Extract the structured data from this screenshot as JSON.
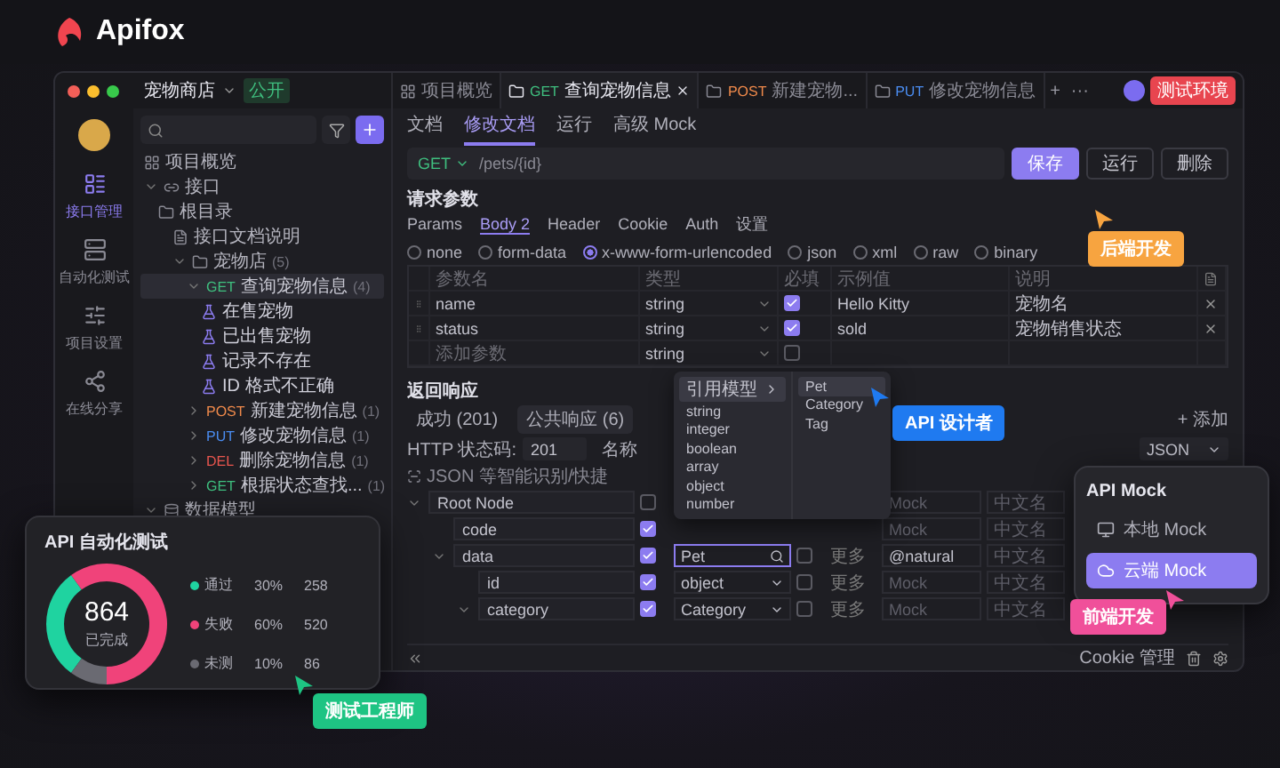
{
  "header": {
    "brand": "Apifox"
  },
  "window": {
    "project": "宠物商店",
    "visibility": "公开",
    "environment": "测试环境",
    "add_tab": "+",
    "more_tabs": "···",
    "tabs": [
      {
        "kind": "overview",
        "label": "项目概览",
        "selected": false
      },
      {
        "kind": "api",
        "method": "GET",
        "color": "#3fbf7f",
        "label": "查询宠物信息",
        "selected": true
      },
      {
        "kind": "api",
        "method": "POST",
        "color": "#f08a4b",
        "label": "新建宠物...",
        "selected": false
      },
      {
        "kind": "api",
        "method": "PUT",
        "color": "#4a8cf0",
        "label": "修改宠物信息",
        "selected": false
      }
    ]
  },
  "nav": [
    {
      "kind": "api",
      "label": "接口管理",
      "selected": true
    },
    {
      "kind": "test",
      "label": "自动化测试",
      "selected": false
    },
    {
      "kind": "settings",
      "label": "项目设置",
      "selected": false
    },
    {
      "kind": "share",
      "label": "在线分享",
      "selected": false
    }
  ],
  "tree": {
    "items": [
      {
        "kind": "overview",
        "label": "项目概览",
        "selected": false
      },
      {
        "kind": "api-group",
        "label": "接口",
        "selected": false,
        "expanded": true,
        "children": [
          {
            "kind": "folder",
            "label": "根目录",
            "selected": false,
            "children": [
              {
                "kind": "doc",
                "label": "接口文档说明",
                "selected": false
              },
              {
                "kind": "folder",
                "label": "宠物店",
                "count": "(5)",
                "selected": false,
                "expanded": true,
                "children": [
                  {
                    "kind": "api",
                    "method": "GET",
                    "color": "#3fbf7f",
                    "label": "查询宠物信息",
                    "count": "(4)",
                    "selected": true,
                    "expanded": true,
                    "children": [
                      {
                        "kind": "case",
                        "label": "在售宠物",
                        "selected": false
                      },
                      {
                        "kind": "case",
                        "label": "已出售宠物",
                        "selected": false
                      },
                      {
                        "kind": "case",
                        "label": "记录不存在",
                        "selected": false
                      },
                      {
                        "kind": "case",
                        "label": "ID 格式不正确",
                        "selected": false
                      }
                    ]
                  },
                  {
                    "kind": "api",
                    "method": "POST",
                    "color": "#f08a4b",
                    "label": "新建宠物信息",
                    "count": "(1)",
                    "selected": false,
                    "expanded": false
                  },
                  {
                    "kind": "api",
                    "method": "PUT",
                    "color": "#4a8cf0",
                    "label": "修改宠物信息",
                    "count": "(1)",
                    "selected": false,
                    "expanded": false
                  },
                  {
                    "kind": "api",
                    "method": "DEL",
                    "color": "#e8554e",
                    "label": "删除宠物信息",
                    "count": "(1)",
                    "selected": false,
                    "expanded": false
                  },
                  {
                    "kind": "api",
                    "method": "GET",
                    "color": "#3fbf7f",
                    "label": "根据状态查找...",
                    "count": "(1)",
                    "selected": false,
                    "expanded": false
                  }
                ]
              }
            ]
          }
        ]
      },
      {
        "kind": "model",
        "label": "数据模型",
        "selected": false,
        "expanded": true
      }
    ]
  },
  "doc_tabs": [
    {
      "label": "文档",
      "selected": false
    },
    {
      "label": "修改文档",
      "selected": true
    },
    {
      "label": "运行",
      "selected": false
    },
    {
      "label": "高级 Mock",
      "selected": false
    }
  ],
  "request": {
    "method": "GET",
    "path": "/pets/{id}",
    "buttons": [
      {
        "kind": "primary",
        "label": "保存"
      },
      {
        "kind": "plain",
        "label": "运行"
      },
      {
        "kind": "plain",
        "label": "删除"
      }
    ]
  },
  "params": {
    "title": "请求参数",
    "tabs": [
      {
        "label": "Params",
        "selected": false
      },
      {
        "label": "Body",
        "count": "2",
        "selected": true
      },
      {
        "label": "Header",
        "selected": false
      },
      {
        "label": "Cookie",
        "selected": false
      },
      {
        "label": "Auth",
        "selected": false
      },
      {
        "label": "设置",
        "selected": false
      }
    ],
    "body_types": [
      {
        "label": "none",
        "selected": false
      },
      {
        "label": "form-data",
        "selected": false
      },
      {
        "label": "x-www-form-urlencoded",
        "selected": true
      },
      {
        "label": "json",
        "selected": false
      },
      {
        "label": "xml",
        "selected": false
      },
      {
        "label": "raw",
        "selected": false
      },
      {
        "label": "binary",
        "selected": false
      }
    ],
    "columns": [
      "参数名",
      "类型",
      "必填",
      "示例值",
      "说明"
    ],
    "rows": [
      {
        "name": "name",
        "type": "string",
        "required": true,
        "example": "Hello Kitty",
        "description": "宠物名"
      },
      {
        "name": "status",
        "type": "string",
        "required": true,
        "example": "sold",
        "description": "宠物销售状态"
      },
      {
        "placeholder": "添加参数",
        "type": "string",
        "required": false
      }
    ]
  },
  "response": {
    "title": "返回响应",
    "add": "+ 添加",
    "tabs": [
      {
        "label": "成功 (201)",
        "selected": false
      },
      {
        "label": "公共响应 (6)",
        "selected": true
      }
    ],
    "status_label": "HTTP 状态码:",
    "status": "201",
    "name_label": "名称",
    "format": "JSON",
    "hint": "JSON 等智能识别/快捷",
    "rows": [
      {
        "name": "Root Node",
        "required": false,
        "expanded": true,
        "mock_placeholder": "Mock",
        "cn_placeholder": "中文名",
        "children": [
          {
            "name": "code",
            "required": true,
            "mock_placeholder": "Mock",
            "cn_placeholder": "中文名"
          },
          {
            "name": "data",
            "kind": "search",
            "type": "Pet",
            "required": true,
            "nullable": false,
            "more": "更多",
            "mock": "@natural",
            "cn_placeholder": "中文名",
            "expanded": true,
            "children": [
              {
                "name": "id",
                "kind": "select",
                "type": "object",
                "required": true,
                "nullable": false,
                "more": "更多",
                "mock_placeholder": "Mock",
                "cn_placeholder": "中文名"
              },
              {
                "name": "category",
                "kind": "select",
                "type": "Category",
                "required": true,
                "nullable": false,
                "more": "更多",
                "mock_placeholder": "Mock",
                "cn_placeholder": "中文名",
                "expanded": true
              }
            ]
          }
        ]
      }
    ]
  },
  "type_menu": {
    "items": [
      {
        "label": "引用模型",
        "submenu": true,
        "selected": true
      },
      {
        "label": "string",
        "selected": false
      },
      {
        "label": "integer",
        "selected": false
      },
      {
        "label": "boolean",
        "selected": false
      },
      {
        "label": "array",
        "selected": false
      },
      {
        "label": "object",
        "selected": false
      },
      {
        "label": "number",
        "selected": false
      }
    ],
    "submenu": [
      {
        "label": "Pet",
        "selected": true
      },
      {
        "label": "Category",
        "selected": false
      },
      {
        "label": "Tag",
        "selected": false
      }
    ]
  },
  "footer": {
    "cookie": "Cookie 管理"
  },
  "test_card": {
    "title": "API 自动化测试",
    "total": "864",
    "total_label": "已完成",
    "chart_data": {
      "type": "donut",
      "categories": [
        "通过",
        "失败",
        "未测"
      ],
      "values": [
        30,
        60,
        10
      ]
    },
    "legend": [
      {
        "percent": "30%",
        "count": "258",
        "color": "#1fd3a0"
      },
      {
        "percent": "60%",
        "count": "520",
        "color": "#f0437a"
      },
      {
        "percent": "10%",
        "count": "86",
        "color": "#6a6a72"
      }
    ]
  },
  "mock_card": {
    "title": "API Mock",
    "options": [
      {
        "kind": "local",
        "label": "本地 Mock",
        "selected": false
      },
      {
        "kind": "cloud",
        "label": "云端 Mock",
        "selected": true
      }
    ]
  },
  "role_tags": [
    {
      "kind": "backend",
      "label": "后端开发",
      "color": "#f7a440"
    },
    {
      "kind": "designer",
      "label": "API 设计者",
      "color": "#1f7af0"
    },
    {
      "kind": "frontend",
      "label": "前端开发",
      "color": "#f0509a"
    },
    {
      "kind": "tester",
      "label": "测试工程师",
      "color": "#1ec483"
    }
  ]
}
